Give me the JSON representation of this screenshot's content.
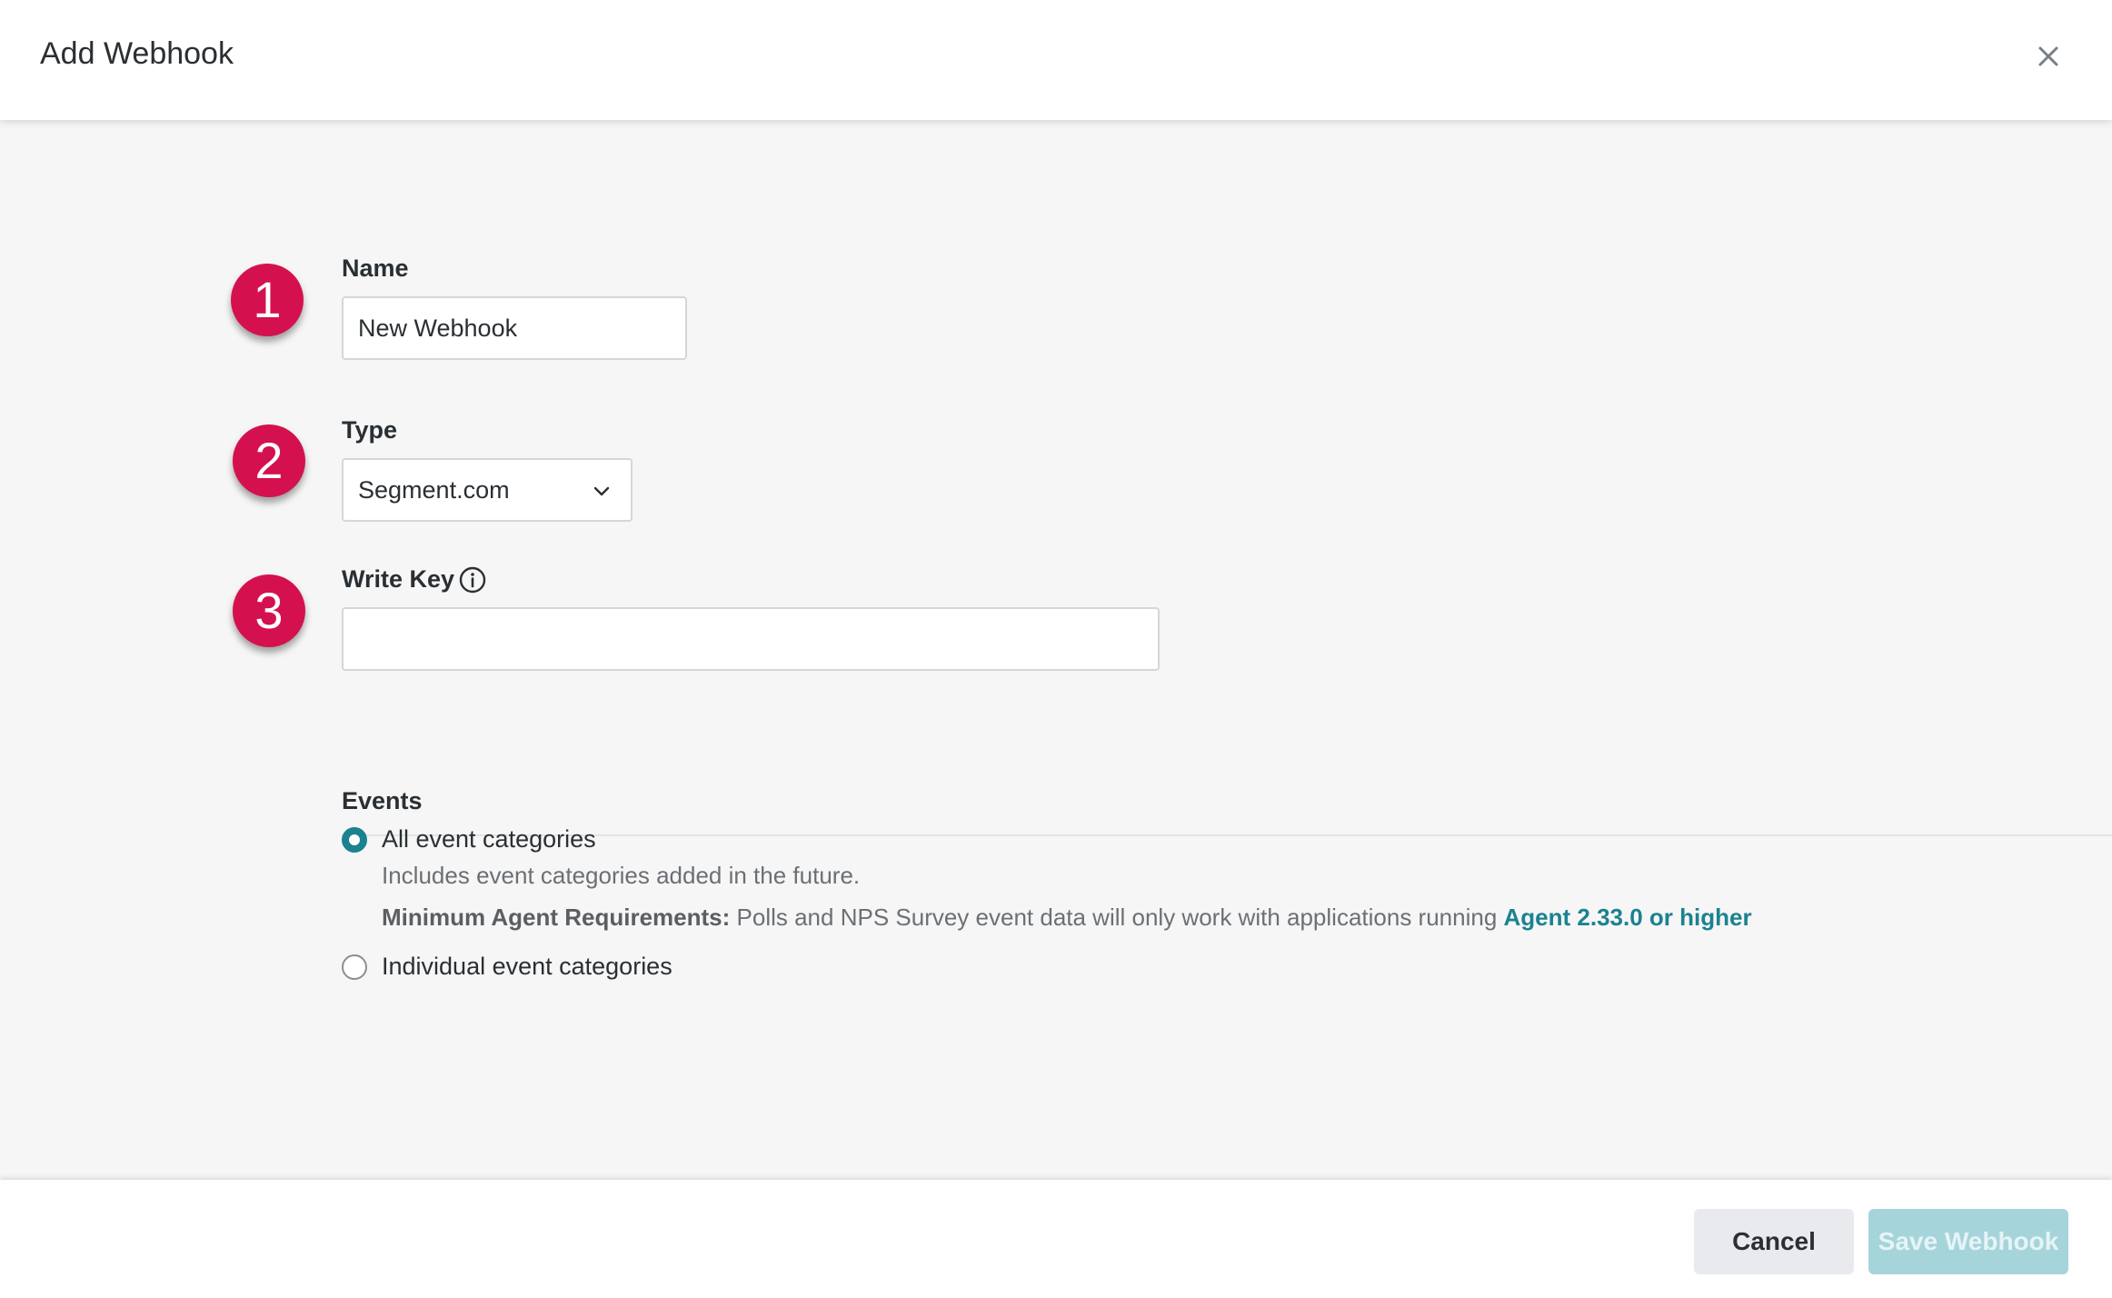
{
  "dialog": {
    "title": "Add Webhook",
    "close_icon": "close-icon"
  },
  "steps": [
    "1",
    "2",
    "3"
  ],
  "form": {
    "name": {
      "label": "Name",
      "value": "New Webhook"
    },
    "type": {
      "label": "Type",
      "value": "Segment.com",
      "icon": "chevron-down-icon"
    },
    "write_key": {
      "label": "Write Key",
      "value": "",
      "icon": "info-icon"
    }
  },
  "events": {
    "label": "Events",
    "options": [
      {
        "label": "All event categories",
        "selected": true
      },
      {
        "label": "Individual event categories",
        "selected": false
      }
    ],
    "hint": "Includes event categories added in the future.",
    "requirements_label": "Minimum Agent Requirements:",
    "requirements_text": " Polls and NPS Survey event data will only work with applications running ",
    "requirements_link": "Agent 2.33.0 or higher"
  },
  "footer": {
    "cancel_label": "Cancel",
    "save_label": "Save Webhook"
  },
  "colors": {
    "accent": "#1b8290",
    "step_badge": "#d4114e",
    "save_disabled": "#a6d4db"
  }
}
